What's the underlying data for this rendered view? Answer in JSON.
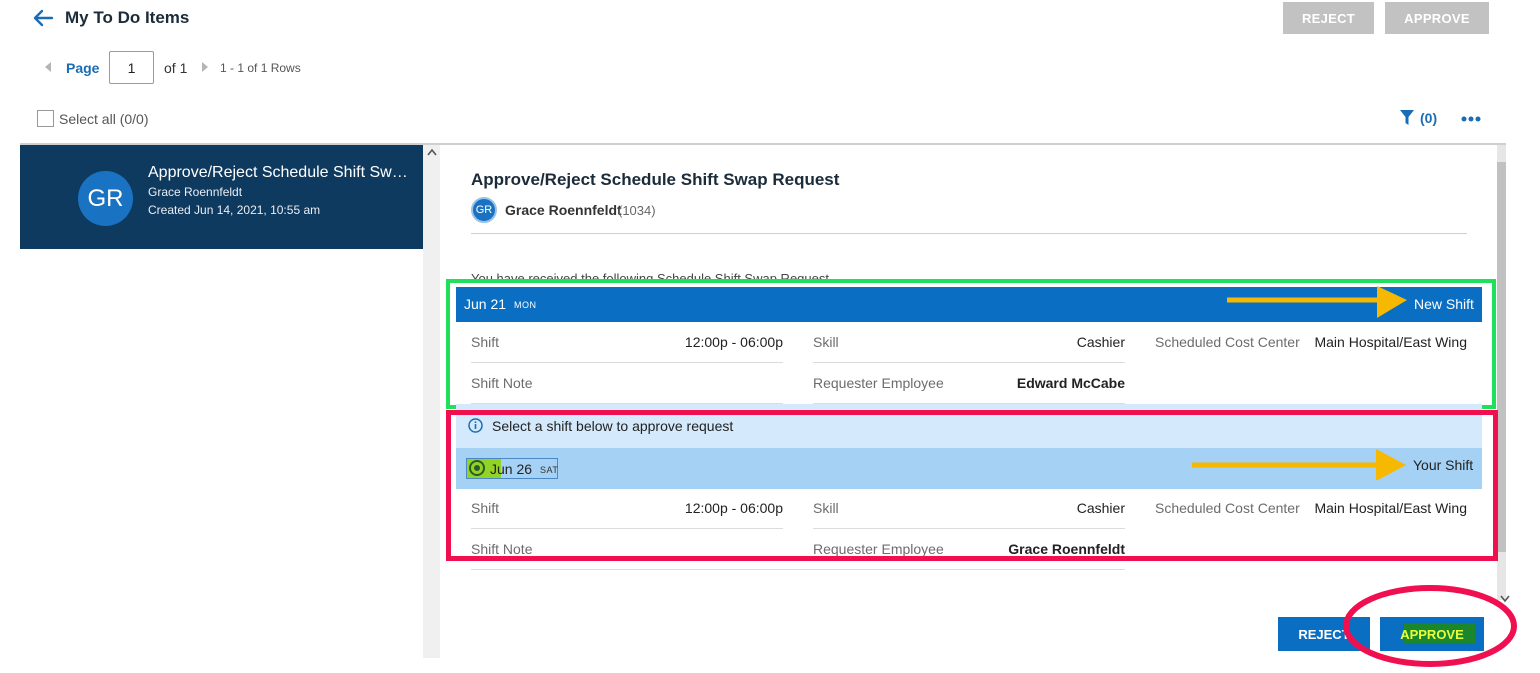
{
  "header": {
    "title": "My To Do Items",
    "reject_label": "REJECT",
    "approve_label": "APPROVE"
  },
  "pager": {
    "page_label": "Page",
    "page_value": "1",
    "of_label": "of 1",
    "rows_label": "1 - 1 of 1 Rows"
  },
  "toolbar": {
    "select_all_label": "Select all (0/0)",
    "filter_count": "(0)"
  },
  "list": {
    "items": [
      {
        "initials": "GR",
        "title": "Approve/Reject Schedule Shift Swap Request",
        "name": "Grace Roennfeldt",
        "created": "Created Jun 14, 2021, 10:55 am"
      }
    ]
  },
  "detail": {
    "title": "Approve/Reject Schedule Shift Swap Request",
    "initials": "GR",
    "name": "Grace Roennfeldt",
    "id": "(1034)",
    "received_text": "You have received the following Schedule Shift Swap Request",
    "new_shift": {
      "date": "Jun 21",
      "day": "MON",
      "tag": "New Shift",
      "shift_label": "Shift",
      "shift_value": "12:00p - 06:00p",
      "skill_label": "Skill",
      "skill_value": "Cashier",
      "cost_label": "Scheduled Cost Center",
      "cost_value": "Main Hospital/East Wing",
      "note_label": "Shift Note",
      "requester_label": "Requester Employee",
      "requester_value": "Edward McCabe"
    },
    "select_info": "Select a shift below to approve request",
    "your_shift": {
      "date": "Jun 26",
      "day": "SAT",
      "tag": "Your Shift",
      "shift_label": "Shift",
      "shift_value": "12:00p - 06:00p",
      "skill_label": "Skill",
      "skill_value": "Cashier",
      "cost_label": "Scheduled Cost Center",
      "cost_value": "Main Hospital/East Wing",
      "note_label": "Shift Note",
      "requester_label": "Requester Employee",
      "requester_value": "Grace Roennfeldt"
    },
    "reject_label": "REJECT",
    "approve_label": "APPROVE"
  },
  "colors": {
    "primary": "#0a6fc2",
    "list_selected": "#0f3a5f",
    "annotation_green": "#1ee05a",
    "annotation_red": "#f0104f",
    "annotation_arrow": "#f6b800"
  }
}
